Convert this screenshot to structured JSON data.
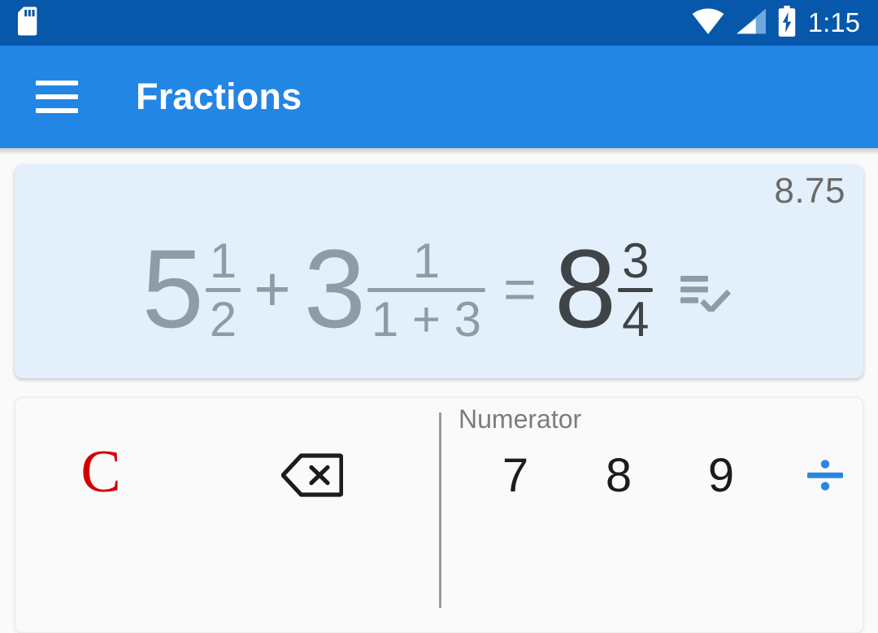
{
  "status_bar": {
    "time": "1:15",
    "icons": [
      "sd-card-icon",
      "wifi-icon",
      "cell-signal-icon",
      "battery-charging-icon"
    ],
    "background_color": "#0757ab"
  },
  "app_bar": {
    "title": "Fractions",
    "menu_icon": "hamburger-menu-icon",
    "background_color": "#2286e5"
  },
  "display": {
    "decimal_value": "8.75",
    "background_color": "#e3f0fb",
    "faded_color": "#8e9ca8",
    "result_color": "#3f4448",
    "expression": {
      "operand1": {
        "whole": "5",
        "numerator": "1",
        "denominator": "2"
      },
      "operator1": "+",
      "operand2": {
        "whole": "3",
        "numerator": "1",
        "denominator": "1 + 3"
      },
      "equals": "=",
      "result": {
        "whole": "8",
        "numerator": "3",
        "denominator": "4"
      }
    },
    "result_action_icon": "playlist-add-check-icon"
  },
  "keypad": {
    "section_label": "Numerator",
    "clear_label": "C",
    "clear_color": "#d40000",
    "backspace_icon": "backspace-icon",
    "divide_icon": "divide-icon",
    "divide_color": "#2a86e0",
    "digits": [
      "7",
      "8",
      "9"
    ]
  }
}
